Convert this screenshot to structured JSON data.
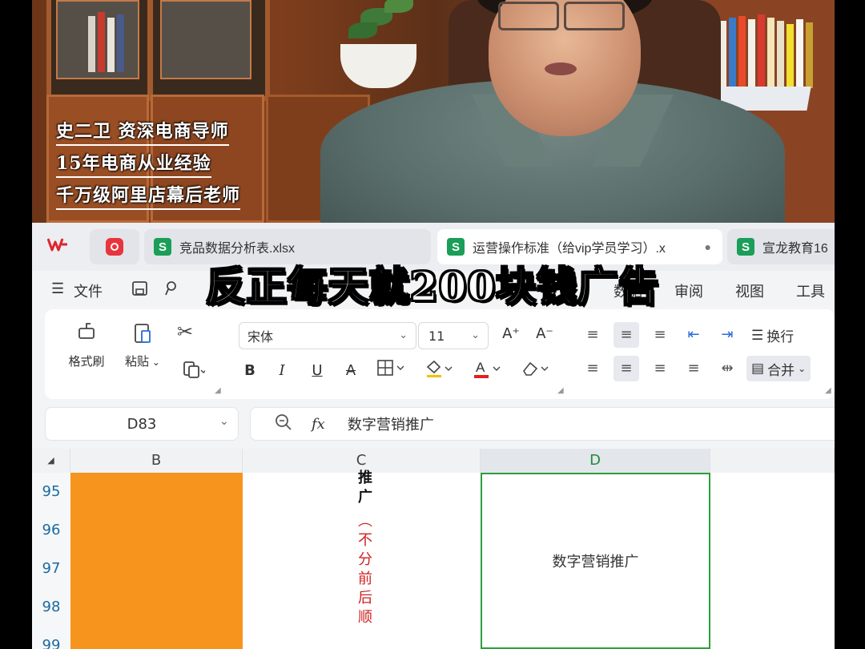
{
  "video": {
    "caption_lines": [
      "史二卫 资深电商导师",
      "15年电商从业经验",
      "千万级阿里店幕后老师"
    ]
  },
  "overlay_title": "反正每天就200块钱广告",
  "tabs": [
    {
      "icon": "wps-logo-icon",
      "label": "W"
    },
    {
      "icon": "pdf-icon",
      "label": ""
    },
    {
      "icon": "sheet-icon",
      "badge": "S",
      "label": "竞品数据分析表.xlsx"
    },
    {
      "icon": "sheet-icon",
      "badge": "S",
      "label": "运营操作标准（给vip学员学习）.x",
      "close": "●"
    },
    {
      "icon": "sheet-icon",
      "badge": "S",
      "label": "宣龙教育16"
    }
  ],
  "menu": {
    "file": "文件",
    "hamburger": "☰",
    "items": [
      "数据",
      "审阅",
      "视图",
      "工具"
    ]
  },
  "ribbon": {
    "format_painter": "格式刷",
    "paste": "粘贴",
    "font_name": "宋体",
    "font_size": "11",
    "wrap": "换行",
    "merge": "合并",
    "grow": "A⁺",
    "shrink": "A⁻"
  },
  "formula": {
    "cell_ref": "D83",
    "fx": "fx",
    "content": "数字营销推广"
  },
  "grid": {
    "columns": [
      "B",
      "C",
      "D"
    ],
    "rows": [
      "95",
      "96",
      "97",
      "98",
      "99"
    ],
    "c_black_text": "推广",
    "c_red_text": "（不分前后顺",
    "d_cell": "数字营销推广"
  }
}
